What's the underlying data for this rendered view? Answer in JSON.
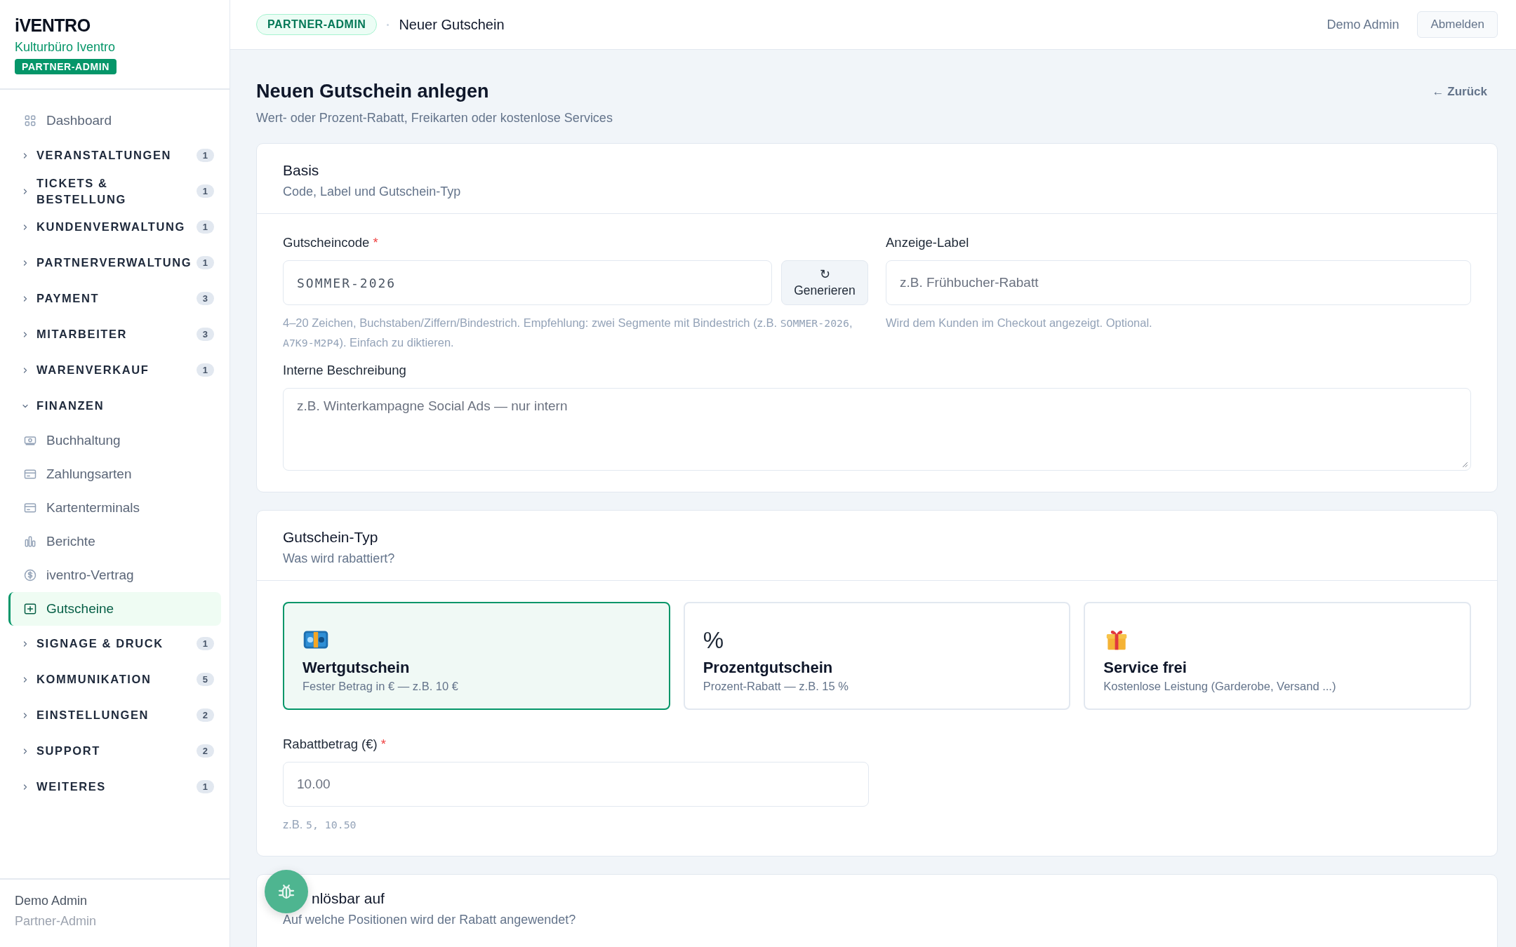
{
  "brand": {
    "logo": "iVENTRO",
    "org": "Kulturbüro Iventro",
    "role_badge": "PARTNER-ADMIN"
  },
  "sidebar": {
    "items": [
      {
        "kind": "link",
        "label": "Dashboard",
        "selected": false
      },
      {
        "kind": "section",
        "label": "VERANSTALTUNGEN",
        "count": "1",
        "expanded": false
      },
      {
        "kind": "section",
        "label": "TICKETS & BESTELLUNG",
        "count": "1",
        "expanded": false
      },
      {
        "kind": "section",
        "label": "KUNDENVERWALTUNG",
        "count": "1",
        "expanded": false
      },
      {
        "kind": "section",
        "label": "PARTNERVERWALTUNG",
        "count": "1",
        "expanded": false
      },
      {
        "kind": "section",
        "label": "PAYMENT",
        "count": "3",
        "expanded": false
      },
      {
        "kind": "section",
        "label": "MITARBEITER",
        "count": "3",
        "expanded": false
      },
      {
        "kind": "section",
        "label": "WARENVERKAUF",
        "count": "1",
        "expanded": false
      },
      {
        "kind": "section",
        "label": "FINANZEN",
        "expanded": true,
        "children": [
          {
            "label": "Buchhaltung",
            "selected": false
          },
          {
            "label": "Zahlungsarten",
            "selected": false
          },
          {
            "label": "Kartenterminals",
            "selected": false
          },
          {
            "label": "Berichte",
            "selected": false
          },
          {
            "label": "iventro-Vertrag",
            "selected": false
          },
          {
            "label": "Gutscheine",
            "selected": true
          }
        ]
      },
      {
        "kind": "section",
        "label": "SIGNAGE & DRUCK",
        "count": "1",
        "expanded": false
      },
      {
        "kind": "section",
        "label": "KOMMUNIKATION",
        "count": "5",
        "expanded": false
      },
      {
        "kind": "section",
        "label": "EINSTELLUNGEN",
        "count": "2",
        "expanded": false
      },
      {
        "kind": "section",
        "label": "SUPPORT",
        "count": "2",
        "expanded": false
      },
      {
        "kind": "section",
        "label": "WEITERES",
        "count": "1",
        "expanded": false
      }
    ]
  },
  "sidebar_user": {
    "name": "Demo Admin",
    "role": "Partner-Admin"
  },
  "header": {
    "badge": "PARTNER-ADMIN",
    "title": "Neuer Gutschein",
    "user": "Demo Admin",
    "logout": "Abmelden"
  },
  "page": {
    "title": "Neuen Gutschein anlegen",
    "subtitle": "Wert- oder Prozent-Rabatt, Freikarten oder kostenlose Services",
    "back": "← Zurück"
  },
  "basis": {
    "title": "Basis",
    "subtitle": "Code, Label und Gutschein-Typ",
    "code": {
      "label": "Gutscheincode",
      "required_mark": "*",
      "value": "SOMMER-2026",
      "button_icon": "↻",
      "button": "Generieren",
      "help": [
        {
          "kind": "text",
          "text": "4–20 Zeichen, Buchstaben/Ziffern/Bindestrich. Empfehlung: zwei Segmente mit Bindestrich (z.B. "
        },
        {
          "kind": "code",
          "text": "SOMMER-2026"
        },
        {
          "kind": "text",
          "text": ", "
        },
        {
          "kind": "code",
          "text": "A7K9-M2P4"
        },
        {
          "kind": "text",
          "text": "). Einfach zu diktieren."
        }
      ]
    },
    "label": {
      "label": "Anzeige-Label",
      "placeholder": "z.B. Frühbucher-Rabatt",
      "help": "Wird dem Kunden im Checkout angezeigt. Optional."
    },
    "description": {
      "label": "Interne Beschreibung",
      "placeholder": "z.B. Winterkampagne Social Ads — nur intern"
    }
  },
  "type": {
    "title": "Gutschein-Typ",
    "subtitle": "Was wird rabattiert?",
    "options": [
      {
        "kind": "money",
        "title": "Wertgutschein",
        "description": "Fester Betrag in € — z.B. 10 €",
        "selected": true
      },
      {
        "kind": "percent",
        "symbol": "%",
        "title": "Prozentgutschein",
        "description": "Prozent-Rabatt — z.B. 15 %",
        "selected": false
      },
      {
        "kind": "gift",
        "title": "Service frei",
        "description": "Kostenlose Leistung (Garderobe, Versand ...)",
        "selected": false
      }
    ],
    "amount": {
      "label": "Rabattbetrag (€)",
      "required_mark": "*",
      "value": "10.00",
      "help": [
        {
          "kind": "text",
          "text": "z.B. "
        },
        {
          "kind": "code",
          "text": "5, 10.50"
        }
      ]
    }
  },
  "redeem": {
    "title": "nlösbar auf",
    "subtitle": "Auf welche Positionen wird der Rabatt angewendet?"
  }
}
